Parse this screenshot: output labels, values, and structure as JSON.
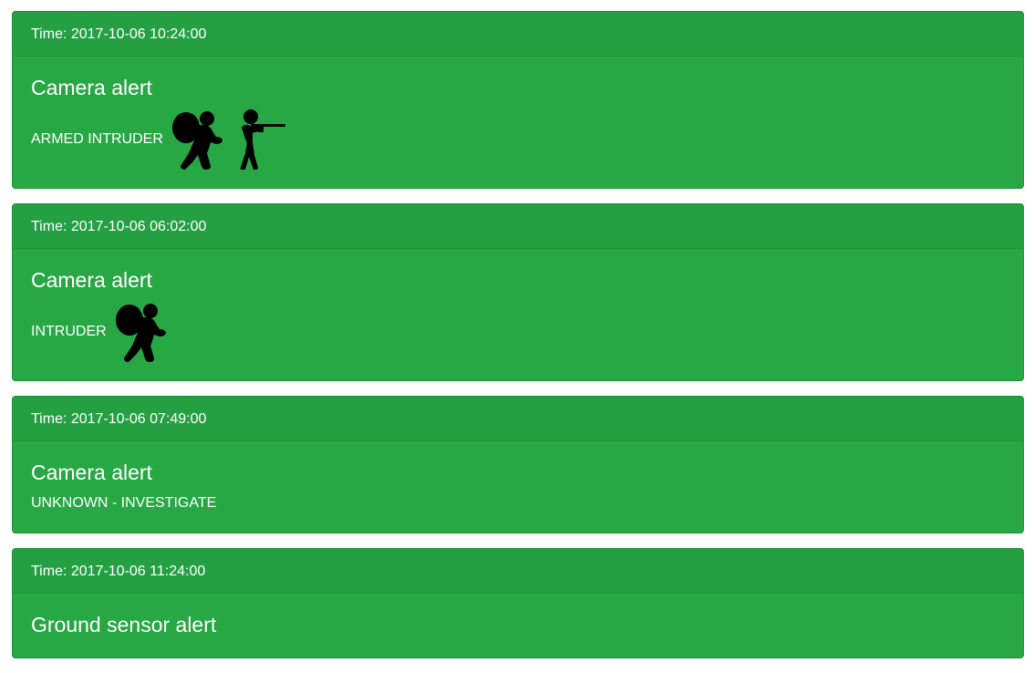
{
  "colors": {
    "card_bg": "#28a745",
    "header_bg": "#24a042",
    "text": "#ffffff",
    "icon": "#000000"
  },
  "alerts": [
    {
      "time_label": "Time: 2017-10-06 10:24:00",
      "title": "Camera alert",
      "text": "ARMED INTRUDER",
      "icons": [
        "intruder-with-bag-icon",
        "armed-person-rifle-icon"
      ]
    },
    {
      "time_label": "Time: 2017-10-06 06:02:00",
      "title": "Camera alert",
      "text": "INTRUDER",
      "icons": [
        "intruder-with-bag-icon"
      ]
    },
    {
      "time_label": "Time: 2017-10-06 07:49:00",
      "title": "Camera alert",
      "text": "UNKNOWN - INVESTIGATE",
      "icons": []
    },
    {
      "time_label": "Time: 2017-10-06 11:24:00",
      "title": "Ground sensor alert",
      "text": "",
      "icons": []
    }
  ]
}
